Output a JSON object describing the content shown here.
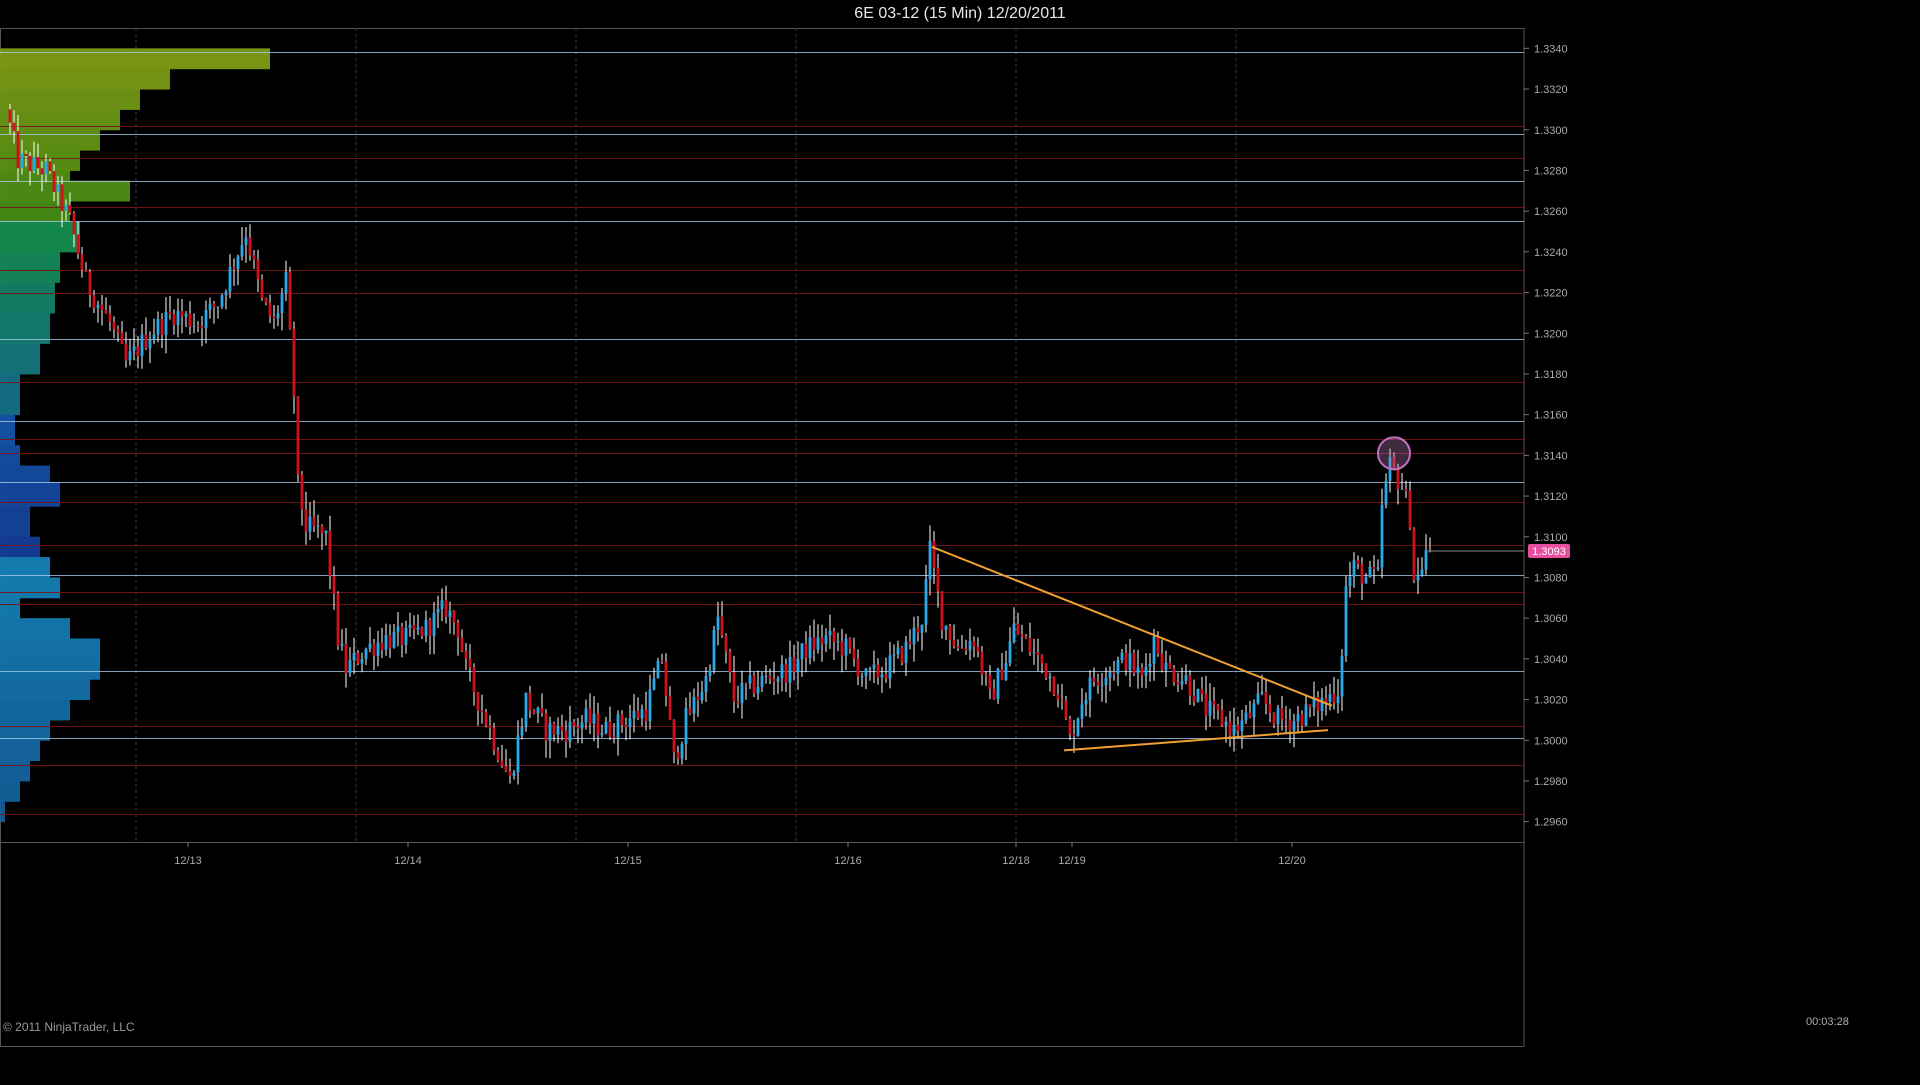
{
  "title": "6E 03-12 (15 Min)  12/20/2011",
  "copyright": "© 2011 NinjaTrader, LLC",
  "timer": "00:03:28",
  "colors": {
    "up": "#2aa8e8",
    "down": "#d0101a",
    "wick": "#ffffff",
    "trend": "#f0a030",
    "h_blue": "#a8c8e8",
    "h_red": "#7a1414",
    "badge": "#e84fa0",
    "circle": "#c070c0",
    "vsep": "#3a3a3a",
    "panel": "#3a3a3a"
  },
  "chart_data": {
    "type": "candlestick",
    "symbol": "6E 03-12",
    "interval": "15 Min",
    "ylim": [
      1.295,
      1.335
    ],
    "y_ticks": [
      "1.3340",
      "1.3320",
      "1.3300",
      "1.3280",
      "1.3260",
      "1.3240",
      "1.3220",
      "1.3200",
      "1.3180",
      "1.3160",
      "1.3140",
      "1.3120",
      "1.3100",
      "1.3080",
      "1.3060",
      "1.3040",
      "1.3020",
      "1.3000",
      "1.2980",
      "1.2960"
    ],
    "x_labels": [
      {
        "label": "12/13",
        "bar": 45
      },
      {
        "label": "12/14",
        "bar": 100
      },
      {
        "label": "12/15",
        "bar": 155
      },
      {
        "label": "12/16",
        "bar": 210
      },
      {
        "label": "12/18",
        "bar": 252
      },
      {
        "label": "12/19",
        "bar": 266
      },
      {
        "label": "12/20",
        "bar": 321
      }
    ],
    "session_separators": [
      32,
      87,
      142,
      197,
      252,
      307
    ],
    "anchors": [
      [
        0,
        1.331
      ],
      [
        3,
        1.3285
      ],
      [
        10,
        1.328
      ],
      [
        16,
        1.3255
      ],
      [
        20,
        1.3225
      ],
      [
        26,
        1.3205
      ],
      [
        30,
        1.3185
      ],
      [
        36,
        1.32
      ],
      [
        42,
        1.321
      ],
      [
        48,
        1.3205
      ],
      [
        53,
        1.3215
      ],
      [
        60,
        1.325
      ],
      [
        64,
        1.3215
      ],
      [
        67,
        1.3205
      ],
      [
        70,
        1.3225
      ],
      [
        72,
        1.317
      ],
      [
        73,
        1.3125
      ],
      [
        75,
        1.3105
      ],
      [
        80,
        1.31
      ],
      [
        83,
        1.305
      ],
      [
        85,
        1.3035
      ],
      [
        90,
        1.3045
      ],
      [
        95,
        1.305
      ],
      [
        100,
        1.305
      ],
      [
        105,
        1.3055
      ],
      [
        110,
        1.3065
      ],
      [
        113,
        1.3055
      ],
      [
        115,
        1.3035
      ],
      [
        118,
        1.302
      ],
      [
        122,
        1.3
      ],
      [
        126,
        1.298
      ],
      [
        130,
        1.302
      ],
      [
        135,
        1.3005
      ],
      [
        140,
        1.3005
      ],
      [
        145,
        1.301
      ],
      [
        150,
        1.3005
      ],
      [
        155,
        1.301
      ],
      [
        160,
        1.3015
      ],
      [
        164,
        1.304
      ],
      [
        167,
        1.299
      ],
      [
        170,
        1.301
      ],
      [
        175,
        1.303
      ],
      [
        178,
        1.306
      ],
      [
        182,
        1.302
      ],
      [
        185,
        1.3025
      ],
      [
        190,
        1.303
      ],
      [
        196,
        1.3035
      ],
      [
        200,
        1.3045
      ],
      [
        205,
        1.305
      ],
      [
        210,
        1.3045
      ],
      [
        215,
        1.303
      ],
      [
        220,
        1.3035
      ],
      [
        225,
        1.3045
      ],
      [
        229,
        1.306
      ],
      [
        231,
        1.3093
      ],
      [
        234,
        1.306
      ],
      [
        238,
        1.3045
      ],
      [
        242,
        1.305
      ],
      [
        244,
        1.3035
      ],
      [
        246,
        1.302
      ],
      [
        250,
        1.304
      ],
      [
        252,
        1.3055
      ],
      [
        256,
        1.3045
      ],
      [
        260,
        1.3035
      ],
      [
        263,
        1.3025
      ],
      [
        266,
        1.3
      ],
      [
        269,
        1.302
      ],
      [
        272,
        1.303
      ],
      [
        276,
        1.3035
      ],
      [
        280,
        1.304
      ],
      [
        284,
        1.303
      ],
      [
        287,
        1.305
      ],
      [
        290,
        1.3035
      ],
      [
        295,
        1.303
      ],
      [
        300,
        1.3015
      ],
      [
        304,
        1.301
      ],
      [
        307,
        1.3005
      ],
      [
        310,
        1.301
      ],
      [
        314,
        1.302
      ],
      [
        318,
        1.301
      ],
      [
        322,
        1.301
      ],
      [
        326,
        1.3015
      ],
      [
        330,
        1.302
      ],
      [
        333,
        1.3025
      ],
      [
        334,
        1.3045
      ],
      [
        335,
        1.3075
      ],
      [
        337,
        1.3085
      ],
      [
        340,
        1.308
      ],
      [
        343,
        1.308
      ],
      [
        344,
        1.3115
      ],
      [
        346,
        1.3135
      ],
      [
        349,
        1.3125
      ],
      [
        351,
        1.311
      ],
      [
        352,
        1.308
      ],
      [
        353,
        1.308
      ],
      [
        355,
        1.3093
      ]
    ],
    "last_price": 1.3093,
    "last_price_label": "1.3093",
    "bar_count": 356,
    "horizontal_lines": [
      {
        "price": 1.3338,
        "color": "blue"
      },
      {
        "price": 1.3298,
        "color": "blue"
      },
      {
        "price": 1.3275,
        "color": "blue"
      },
      {
        "price": 1.3255,
        "color": "blue"
      },
      {
        "price": 1.3197,
        "color": "blue"
      },
      {
        "price": 1.3157,
        "color": "blue"
      },
      {
        "price": 1.3127,
        "color": "blue"
      },
      {
        "price": 1.3081,
        "color": "blue"
      },
      {
        "price": 1.3034,
        "color": "blue"
      },
      {
        "price": 1.3001,
        "color": "blue"
      },
      {
        "price": 1.3302,
        "color": "red"
      },
      {
        "price": 1.3286,
        "color": "red"
      },
      {
        "price": 1.3262,
        "color": "red"
      },
      {
        "price": 1.3231,
        "color": "red"
      },
      {
        "price": 1.322,
        "color": "red"
      },
      {
        "price": 1.3176,
        "color": "red"
      },
      {
        "price": 1.3148,
        "color": "red"
      },
      {
        "price": 1.3141,
        "color": "red"
      },
      {
        "price": 1.3117,
        "color": "red"
      },
      {
        "price": 1.3096,
        "color": "red"
      },
      {
        "price": 1.3073,
        "color": "red"
      },
      {
        "price": 1.3067,
        "color": "red"
      },
      {
        "price": 1.3007,
        "color": "red"
      },
      {
        "price": 1.2988,
        "color": "red"
      },
      {
        "price": 1.2964,
        "color": "red"
      }
    ],
    "poc_line": {
      "price": 1.3307,
      "bar_end": 130
    },
    "trendlines": [
      {
        "from": [
          231,
          1.3095
        ],
        "to": [
          331,
          1.3017
        ]
      },
      {
        "from": [
          264,
          1.2995
        ],
        "to": [
          330,
          1.3005
        ]
      }
    ],
    "marker_circle": {
      "bar": 346,
      "price": 1.3141
    },
    "volume_profile": [
      [
        1.334,
        0.27
      ],
      [
        1.333,
        0.17
      ],
      [
        1.332,
        0.14
      ],
      [
        1.331,
        0.12
      ],
      [
        1.33,
        0.1
      ],
      [
        1.329,
        0.08
      ],
      [
        1.328,
        0.07
      ],
      [
        1.3275,
        0.13
      ],
      [
        1.3265,
        0.07
      ],
      [
        1.3255,
        0.08
      ],
      [
        1.324,
        0.06
      ],
      [
        1.3225,
        0.055
      ],
      [
        1.321,
        0.05
      ],
      [
        1.3195,
        0.04
      ],
      [
        1.318,
        0.02
      ],
      [
        1.316,
        0.015
      ],
      [
        1.3145,
        0.02
      ],
      [
        1.3135,
        0.05
      ],
      [
        1.3127,
        0.06
      ],
      [
        1.3115,
        0.03
      ],
      [
        1.31,
        0.04
      ],
      [
        1.309,
        0.05
      ],
      [
        1.308,
        0.06
      ],
      [
        1.307,
        0.02
      ],
      [
        1.306,
        0.07
      ],
      [
        1.305,
        0.1
      ],
      [
        1.304,
        0.1
      ],
      [
        1.303,
        0.09
      ],
      [
        1.302,
        0.07
      ],
      [
        1.301,
        0.05
      ],
      [
        1.3,
        0.04
      ],
      [
        1.299,
        0.03
      ],
      [
        1.298,
        0.02
      ],
      [
        1.297,
        0.005
      ]
    ]
  }
}
